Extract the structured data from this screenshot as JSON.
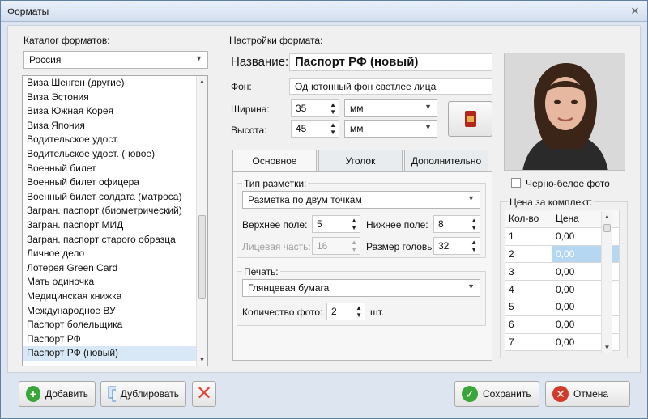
{
  "window": {
    "title": "Форматы",
    "close_glyph": "✕"
  },
  "catalog": {
    "label": "Каталог форматов:",
    "country": "Россия",
    "items": [
      "Виза Шенген (другие)",
      "Виза Эстония",
      "Виза Южная Корея",
      "Виза Япония",
      "Водительское удост.",
      "Водительское удост. (новое)",
      "Военный билет",
      "Военный билет офицера",
      "Военный билет солдата (матроса)",
      "Загран. паспорт (биометрический)",
      "Загран. паспорт МИД",
      "Загран. паспорт старого образца",
      "Личное дело",
      "Лотерея Green Card",
      "Мать одиночка",
      "Медицинская книжка",
      "Международное ВУ",
      "Паспорт болельщика",
      "Паспорт РФ",
      "Паспорт РФ (новый)"
    ],
    "selected_index": 19
  },
  "settings": {
    "label": "Настройки формата:",
    "name_label": "Название:",
    "name_value": "Паспорт РФ (новый)",
    "bg_label": "Фон:",
    "bg_value": "Однотонный фон светлее лица",
    "width_label": "Ширина:",
    "width_value": "35",
    "width_unit": "мм",
    "height_label": "Высота:",
    "height_value": "45",
    "height_unit": "мм"
  },
  "tabs": [
    "Основное",
    "Уголок",
    "Дополнительно"
  ],
  "main_tab": {
    "markup_label": "Тип разметки:",
    "markup_value": "Разметка по двум точкам",
    "top_margin_label": "Верхнее поле:",
    "top_margin_value": "5",
    "bottom_margin_label": "Нижнее поле:",
    "bottom_margin_value": "8",
    "face_label": "Лицевая часть:",
    "face_value": "16",
    "head_label": "Размер головы:",
    "head_value": "32",
    "print_label": "Печать:",
    "paper_value": "Глянцевая бумага",
    "count_label": "Количество фото:",
    "count_value": "2",
    "count_unit": "шт."
  },
  "photo": {
    "bw_label": "Черно-белое фото"
  },
  "price": {
    "label": "Цена за комплект:",
    "col_qty": "Кол-во",
    "col_price": "Цена",
    "rows": [
      {
        "qty": "1",
        "price": "0,00"
      },
      {
        "qty": "2",
        "price": "0,00"
      },
      {
        "qty": "3",
        "price": "0,00"
      },
      {
        "qty": "4",
        "price": "0,00"
      },
      {
        "qty": "5",
        "price": "0,00"
      },
      {
        "qty": "6",
        "price": "0,00"
      },
      {
        "qty": "7",
        "price": "0,00"
      }
    ],
    "selected_row": 1
  },
  "buttons": {
    "add": "Добавить",
    "duplicate": "Дублировать",
    "save": "Сохранить",
    "cancel": "Отмена"
  },
  "colors": {
    "accent": "#6fa3d1",
    "save_green": "#3aa53a",
    "cancel_red": "#d23b2b",
    "delete_red": "#e0463a"
  }
}
